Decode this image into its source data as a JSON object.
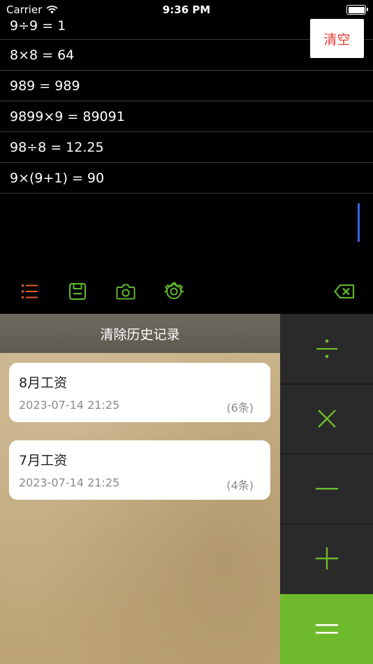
{
  "status_bar": {
    "carrier": "Carrier",
    "time": "9:36 PM"
  },
  "history": [
    {
      "expr": "9÷9 = 1"
    },
    {
      "expr": "8×8 = 64"
    },
    {
      "expr": "989 = 989"
    },
    {
      "expr": "9899×9 = 89091"
    },
    {
      "expr": "98÷8 = 12.25"
    },
    {
      "expr": "9×(9+1) = 90"
    }
  ],
  "clear_button": {
    "label": "清空"
  },
  "toolbar": {
    "icons": [
      "list-icon",
      "save-icon",
      "camera-icon",
      "settings-icon",
      "backspace-icon"
    ]
  },
  "records_panel": {
    "header": "清除历史记录",
    "items": [
      {
        "name": "8月工资",
        "date": "2023-07-14 21:25",
        "count": "(6条)"
      },
      {
        "name": "7月工资",
        "date": "2023-07-14 21:25",
        "count": "(4条)"
      }
    ]
  },
  "operators": [
    "divide",
    "multiply",
    "subtract",
    "add",
    "equals"
  ],
  "colors": {
    "accent_green": "#6fba2c",
    "icon_green": "#5db42a",
    "list_icon_orange": "#e0622b",
    "clear_red": "#e53935",
    "cursor_blue": "#3b67e0"
  }
}
